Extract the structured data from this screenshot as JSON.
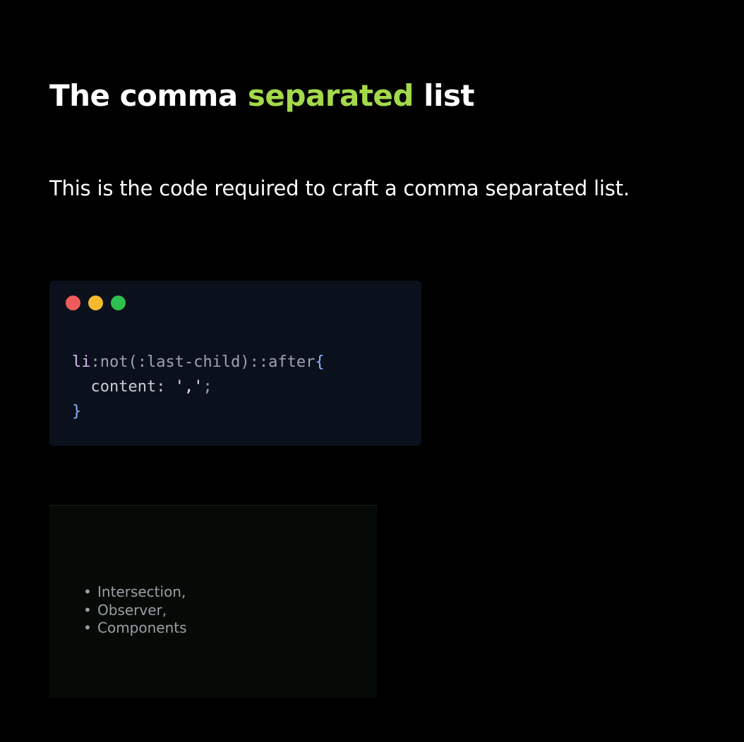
{
  "header": {
    "title_before": "The comma ",
    "title_accent": "separated",
    "title_after": " list",
    "accent_color": "#a3d94a"
  },
  "description": "This is the code required to craft a comma separated list.",
  "code_window": {
    "background": "#0b111c",
    "dots": [
      {
        "name": "close",
        "color": "#ef5b5b"
      },
      {
        "name": "minimize",
        "color": "#f3b92f"
      },
      {
        "name": "maximize",
        "color": "#2ec04f"
      }
    ],
    "code": {
      "line1_selector": "li",
      "line1_pseudo": ":not(:last-child)::after",
      "line1_brace": "{",
      "line2_property": "content: ",
      "line2_value": "','",
      "line2_end": ";",
      "line3_brace": "}"
    }
  },
  "preview": {
    "bullet": "•",
    "items": [
      "Intersection,",
      "Observer,",
      "Components"
    ]
  }
}
